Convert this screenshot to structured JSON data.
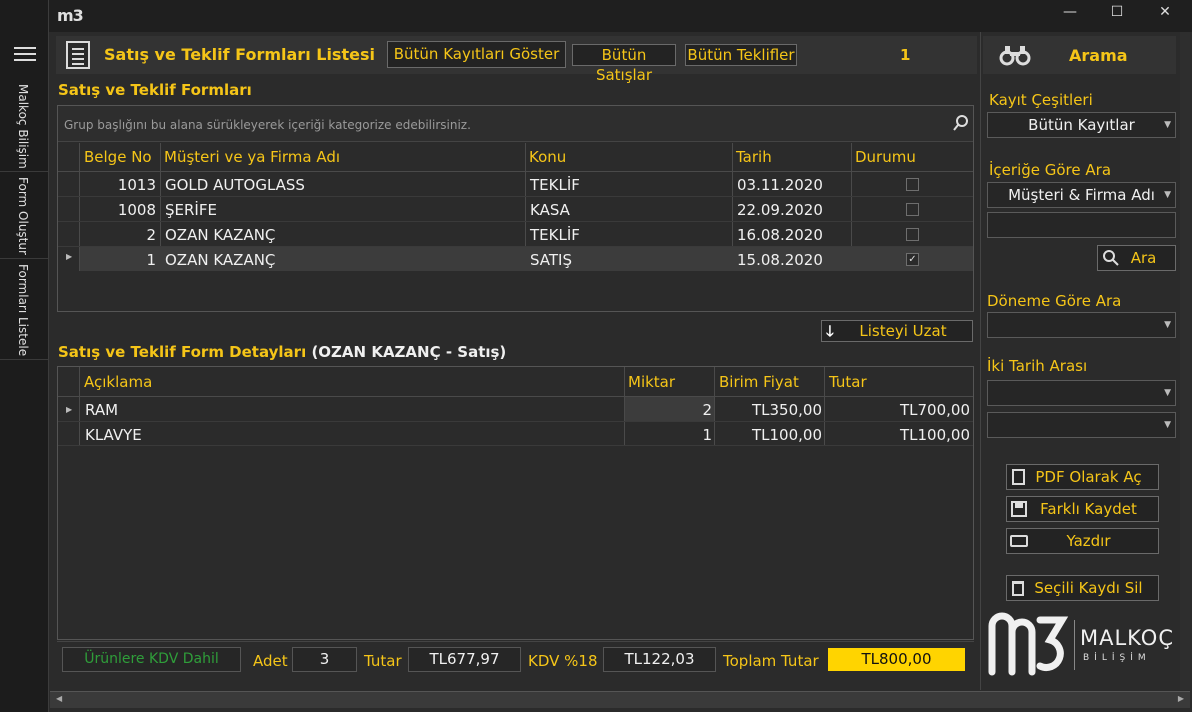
{
  "window": {
    "logo": "m3",
    "minimize": "—",
    "maximize": "☐",
    "close": "✕"
  },
  "sidebar": {
    "menu_icon": "hamburger-icon",
    "items": [
      {
        "label": "Malkoç Bilişim"
      },
      {
        "label": "Form Oluştur"
      },
      {
        "label": "Formları Listele"
      }
    ]
  },
  "header": {
    "title": "Satış ve Teklif Formları Listesi",
    "show_all": "Bütün Kayıtları Göster",
    "sales": "Bütün Satışlar",
    "offers": "Bütün Teklifler",
    "count": "1"
  },
  "forms": {
    "title": "Satış ve Teklif Formları",
    "group_hint": "Grup başlığını bu alana sürükleyerek içeriği kategorize edebilirsiniz.",
    "columns": [
      "Belge No",
      "Müşteri ve ya Firma Adı",
      "Konu",
      "Tarih",
      "Durumu"
    ],
    "rows": [
      {
        "no": "1013",
        "name": "GOLD AUTOGLASS",
        "subject": "TEKLİF",
        "date": "03.11.2020",
        "done": false
      },
      {
        "no": "1008",
        "name": "ŞERİFE",
        "subject": "KASA",
        "date": "22.09.2020",
        "done": false
      },
      {
        "no": "2",
        "name": "OZAN KAZANÇ",
        "subject": "TEKLİF",
        "date": "16.08.2020",
        "done": false
      },
      {
        "no": "1",
        "name": "OZAN KAZANÇ",
        "subject": "SATIŞ",
        "date": "15.08.2020",
        "done": true
      }
    ],
    "extend_button": "Listeyi Uzat"
  },
  "details": {
    "title": "Satış ve Teklif Form Detayları",
    "context": "(OZAN KAZANÇ - Satış)",
    "columns": [
      "Açıklama",
      "Miktar",
      "Birim Fiyat",
      "Tutar"
    ],
    "rows": [
      {
        "desc": "RAM",
        "qty": "2",
        "price": "TL350,00",
        "total": "TL700,00"
      },
      {
        "desc": "KLAVYE",
        "qty": "1",
        "price": "TL100,00",
        "total": "TL100,00"
      }
    ]
  },
  "footer": {
    "vat_included": "Ürünlere KDV Dahil",
    "count_label": "Adet",
    "count": "3",
    "amount_label": "Tutar",
    "amount": "TL677,97",
    "vat_label": "KDV %18",
    "vat": "TL122,03",
    "total_label": "Toplam Tutar",
    "total": "TL800,00"
  },
  "search": {
    "title": "Arama",
    "record_types_label": "Kayıt Çeşitleri",
    "record_type": "Bütün Kayıtlar",
    "content_label": "İçeriğe Göre Ara",
    "content_field": "Müşteri & Firma Adı",
    "content_value": "",
    "search_button": "Ara",
    "period_label": "Döneme Göre Ara",
    "date_range_label": "İki Tarih Arası",
    "pdf": "PDF Olarak Aç",
    "save_as": "Farklı Kaydet",
    "print": "Yazdır",
    "delete": "Seçili Kaydı Sil"
  },
  "brand": {
    "name": "MALKOÇ",
    "sub": "BİLİŞİM",
    "logo": "m3"
  }
}
